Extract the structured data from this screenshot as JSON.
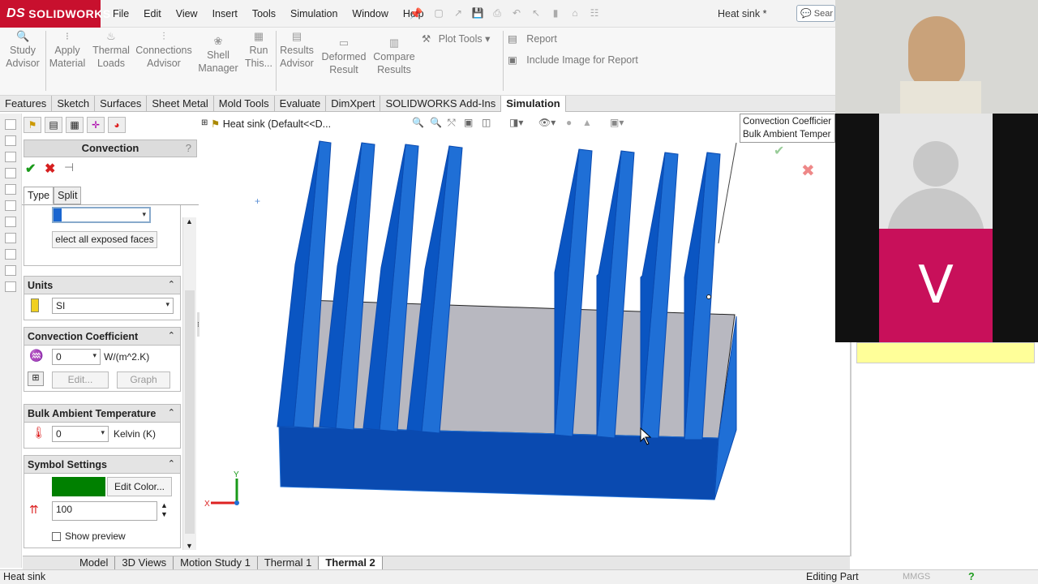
{
  "app": {
    "brand": "SOLIDWORKS",
    "doc_title": "Heat sink *",
    "search_label": "Sear"
  },
  "menu": [
    "File",
    "Edit",
    "View",
    "Insert",
    "Tools",
    "Simulation",
    "Window",
    "Help"
  ],
  "commands": [
    {
      "label": "Study\nAdvisor"
    },
    {
      "label": "Apply\nMaterial"
    },
    {
      "label": "Thermal\nLoads"
    },
    {
      "label": "Connections\nAdvisor"
    },
    {
      "label": "Shell\nManager"
    },
    {
      "label": "Run\nThis..."
    },
    {
      "label": "Results\nAdvisor"
    },
    {
      "label": "Deformed\nResult"
    },
    {
      "label": "Compare\nResults"
    }
  ],
  "cmd_right": {
    "plot_tools": "Plot Tools",
    "report": "Report",
    "include_image": "Include Image for Report"
  },
  "tabs": [
    "Features",
    "Sketch",
    "Surfaces",
    "Sheet Metal",
    "Mold Tools",
    "Evaluate",
    "DimXpert",
    "SOLIDWORKS Add-Ins",
    "Simulation"
  ],
  "active_tab": "Simulation",
  "panel": {
    "title": "Convection",
    "help": "?",
    "ok": "✔",
    "cancel": "✖",
    "type_tabs": [
      "Type",
      "Split"
    ],
    "select_exposed": "elect all exposed faces",
    "units": {
      "header": "Units",
      "value": "SI"
    },
    "conv_coef": {
      "header": "Convection Coefficient",
      "value": "0",
      "unit": "W/(m^2.K)",
      "edit": "Edit...",
      "graph": "Graph"
    },
    "bulk_temp": {
      "header": "Bulk Ambient Temperature",
      "value": "0",
      "unit": "Kelvin (K)"
    },
    "symbol": {
      "header": "Symbol Settings",
      "edit_color": "Edit Color...",
      "size": "100",
      "show_preview": "Show preview",
      "color": "#008000"
    }
  },
  "viewport": {
    "title": "Heat sink  (Default<<D...",
    "tooltip_lines": [
      "Convection Coefficier",
      "Bulk Ambient Temper"
    ],
    "axis_x": "X",
    "axis_y": "Y"
  },
  "bottom_tabs": [
    "Model",
    "3D Views",
    "Motion Study 1",
    "Thermal 1",
    "Thermal 2"
  ],
  "active_bottom_tab": "Thermal 2",
  "status": {
    "left": "Heat sink",
    "mid": "Editing Part",
    "units": "MMGS"
  },
  "video": {
    "letter": "V"
  },
  "colors": {
    "brand": "#c8102e",
    "model_blue": "#1f6fd6",
    "model_dark": "#0a4ab0",
    "base_gray": "#b8b8c0",
    "video_tile": "#c8105a"
  }
}
